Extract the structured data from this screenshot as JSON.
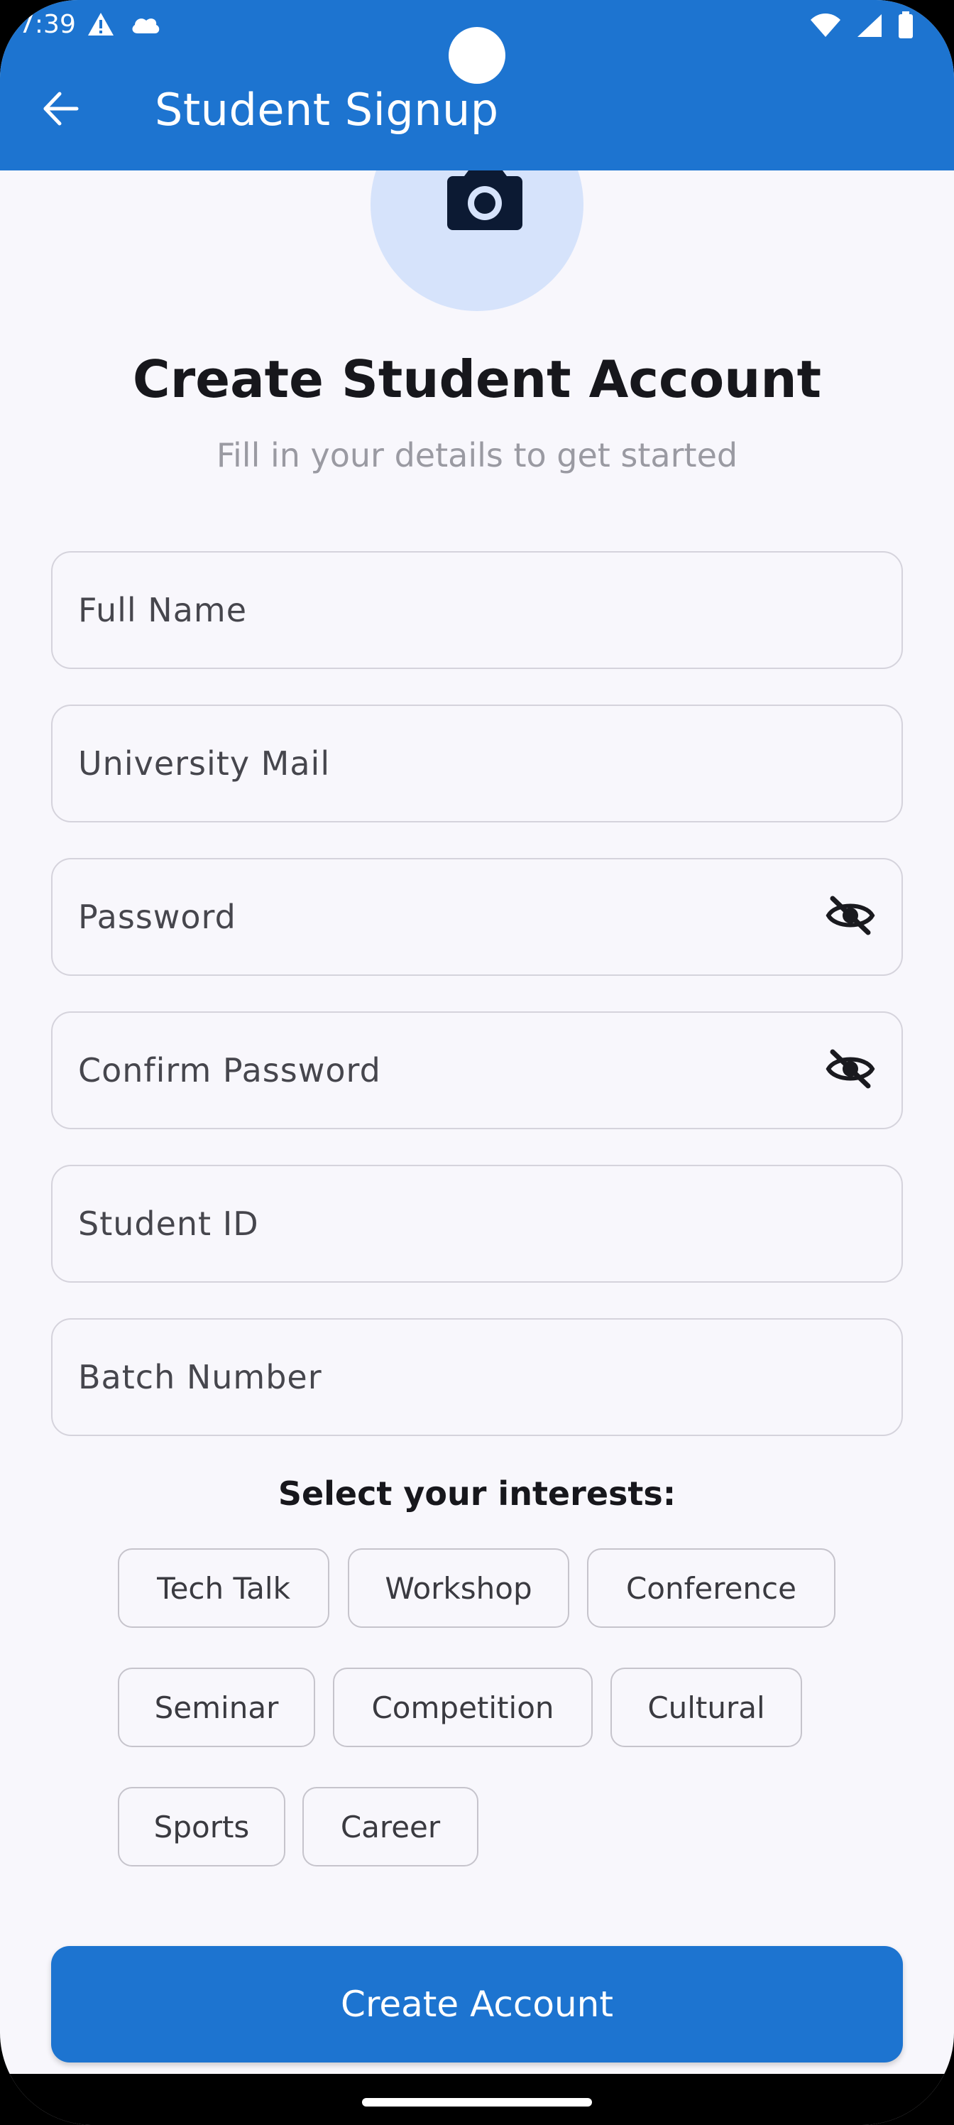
{
  "status_bar": {
    "time": "7:39",
    "left_icons": [
      "warning-icon",
      "cloud-icon"
    ],
    "right_icons": [
      "wifi-icon",
      "signal-icon",
      "battery-icon"
    ]
  },
  "app_bar": {
    "title": "Student Signup",
    "back_icon": "arrow-back-icon",
    "background": "#1d74d0"
  },
  "avatar": {
    "icon": "add-photo-camera-icon",
    "background": "#d6e3fb"
  },
  "header": {
    "title": "Create Student Account",
    "subtitle": "Fill in your details to get started"
  },
  "form": {
    "full_name": {
      "placeholder": "Full Name",
      "value": ""
    },
    "university_mail": {
      "placeholder": "University Mail",
      "value": ""
    },
    "password": {
      "placeholder": "Password",
      "value": "",
      "toggle_icon": "visibility-off-icon"
    },
    "confirm_password": {
      "placeholder": "Confirm Password",
      "value": "",
      "toggle_icon": "visibility-off-icon"
    },
    "student_id": {
      "placeholder": "Student ID",
      "value": ""
    },
    "batch_number": {
      "placeholder": "Batch Number",
      "value": ""
    }
  },
  "interests": {
    "label": "Select your interests:",
    "chips": [
      "Tech Talk",
      "Workshop",
      "Conference",
      "Seminar",
      "Competition",
      "Cultural",
      "Sports",
      "Career"
    ]
  },
  "submit": {
    "label": "Create Account",
    "color": "#1d74d0"
  }
}
